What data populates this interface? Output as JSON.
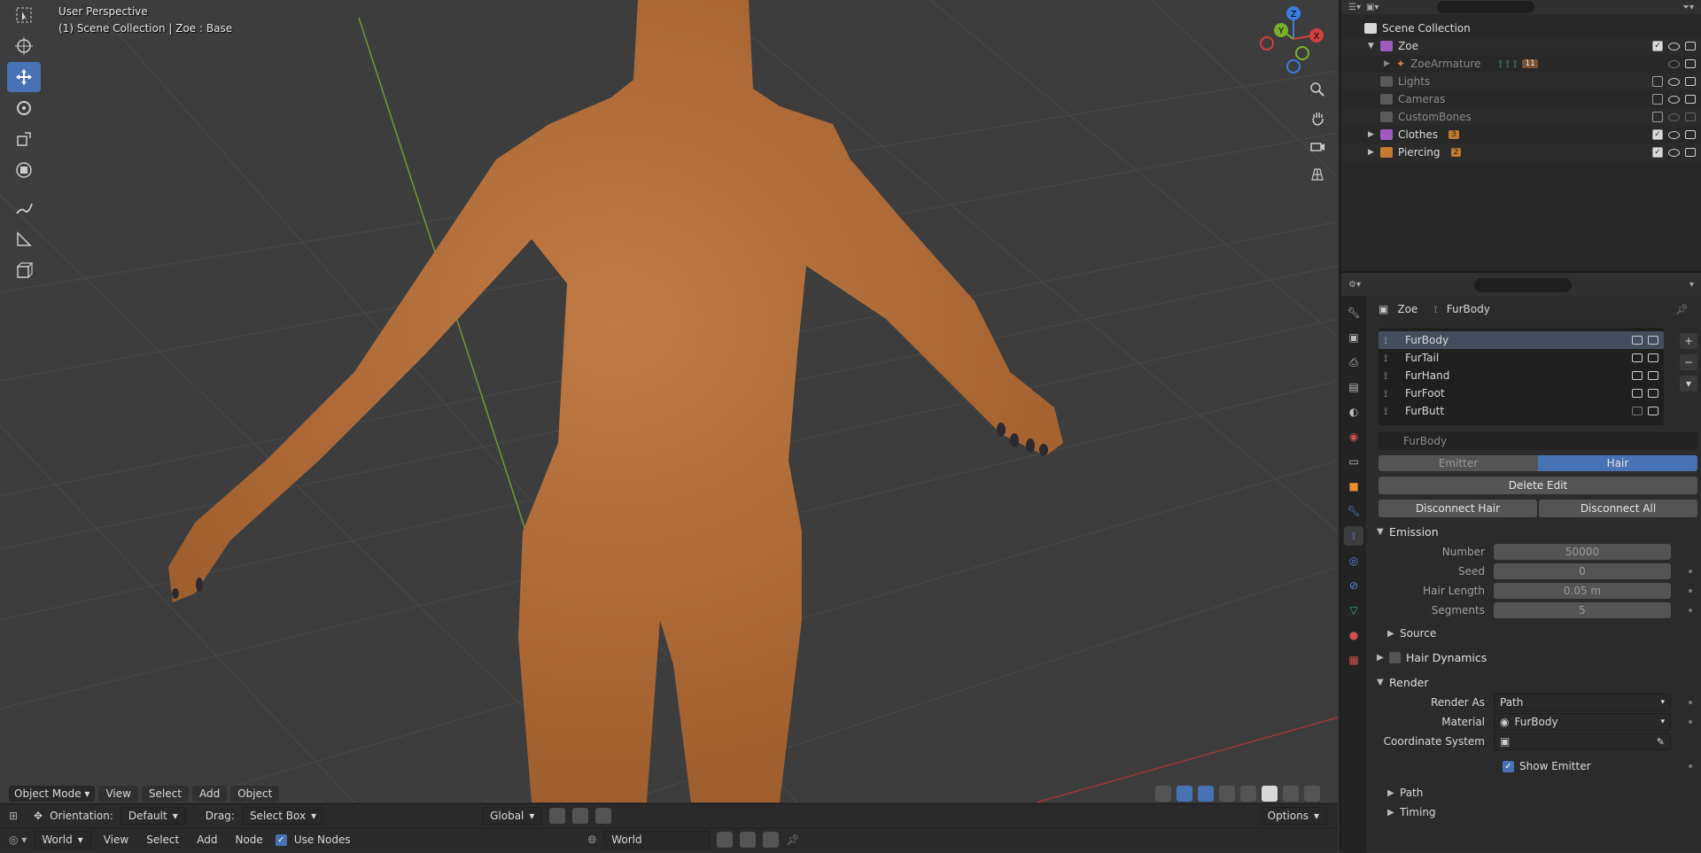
{
  "viewport": {
    "perspective_label": "User Perspective",
    "scene_label": "(1) Scene Collection | Zoe  : Base",
    "header": {
      "mode": "Object Mode",
      "menus": [
        "View",
        "Select",
        "Add",
        "Object"
      ]
    }
  },
  "tool_header": {
    "orientation_label": "Orientation:",
    "orientation_value": "Default",
    "drag_label": "Drag:",
    "drag_value": "Select Box",
    "transform_value": "Global",
    "options_label": "Options"
  },
  "node_header": {
    "world_type": "World",
    "menus": [
      "View",
      "Select",
      "Add",
      "Node"
    ],
    "use_nodes_label": "Use Nodes",
    "world_name": "World"
  },
  "outliner": {
    "root": "Scene Collection",
    "rows": [
      {
        "name": "Zoe",
        "color": "#a05ac0"
      },
      {
        "name": "ZoeArmature",
        "badge": "11"
      },
      {
        "name": "Lights",
        "color": "#5a5a5a"
      },
      {
        "name": "Cameras",
        "color": "#5a5a5a"
      },
      {
        "name": "CustomBones",
        "color": "#5a5a5a"
      },
      {
        "name": "Clothes",
        "color": "#a05ac0",
        "badge": "3"
      },
      {
        "name": "Piercing",
        "color": "#c87a30",
        "badge": "2"
      }
    ]
  },
  "properties": {
    "breadcrumb": {
      "object": "Zoe",
      "system": "FurBody"
    },
    "particle_systems": [
      "FurBody",
      "FurTail",
      "FurHand",
      "FurFoot",
      "FurButt"
    ],
    "settings_name": "FurBody",
    "type_tabs": [
      "Emitter",
      "Hair"
    ],
    "delete_edit": "Delete Edit",
    "disconnect_hair": "Disconnect Hair",
    "disconnect_all": "Disconnect All",
    "emission": {
      "title": "Emission",
      "number_label": "Number",
      "number": "50000",
      "seed_label": "Seed",
      "seed": "0",
      "hair_length_label": "Hair Length",
      "hair_length": "0.05 m",
      "segments_label": "Segments",
      "segments": "5"
    },
    "source_label": "Source",
    "hair_dynamics_label": "Hair Dynamics",
    "render": {
      "title": "Render",
      "render_as_label": "Render As",
      "render_as": "Path",
      "material_label": "Material",
      "material": "FurBody",
      "coord_label": "Coordinate System",
      "show_emitter_label": "Show Emitter"
    },
    "path_label": "Path",
    "timing_label": "Timing"
  },
  "colors": {
    "accent": "#4772b3",
    "fur": "#b8703c"
  }
}
